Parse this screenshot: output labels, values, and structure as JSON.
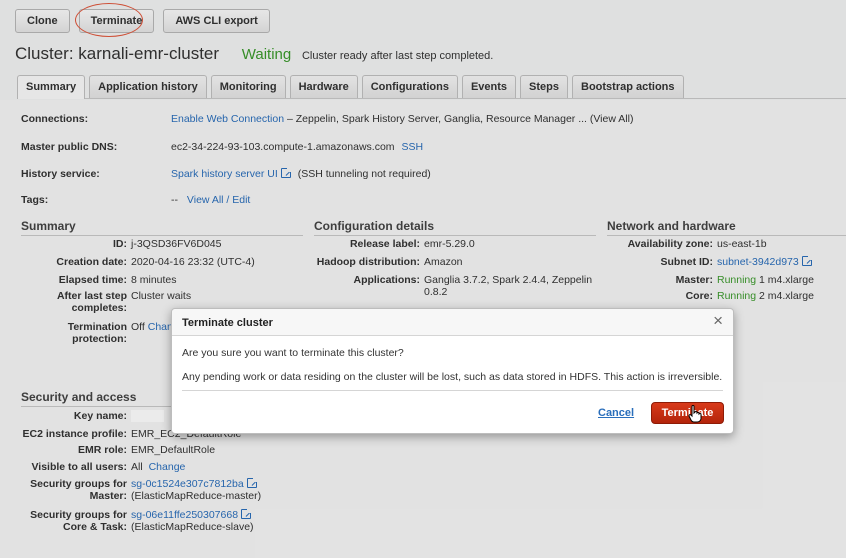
{
  "toolbar": {
    "clone_label": "Clone",
    "terminate_label": "Terminate",
    "export_label": "AWS CLI export"
  },
  "cluster": {
    "title": "Cluster: karnali-emr-cluster",
    "status": "Waiting",
    "status_message": "Cluster ready after last step completed."
  },
  "tabs": [
    {
      "label": "Summary"
    },
    {
      "label": "Application history"
    },
    {
      "label": "Monitoring"
    },
    {
      "label": "Hardware"
    },
    {
      "label": "Configurations"
    },
    {
      "label": "Events"
    },
    {
      "label": "Steps"
    },
    {
      "label": "Bootstrap actions"
    }
  ],
  "overview": {
    "connections_key": "Connections:",
    "connections_link": "Enable Web Connection",
    "connections_text": " – Zeppelin, Spark History Server, Ganglia, Resource Manager ... (View All)",
    "dns_key": "Master public DNS:",
    "dns_value": "ec2-34-224-93-103.compute-1.amazonaws.com",
    "dns_ssh": "SSH",
    "history_key": "History service:",
    "history_link": "Spark history server UI",
    "history_note": "(SSH tunneling not required)",
    "tags_key": "Tags:",
    "tags_value": "--",
    "tags_link": "View All / Edit"
  },
  "summary": {
    "heading": "Summary",
    "id_key": "ID:",
    "id_value": "j-3QSD36FV6D045",
    "creation_key": "Creation date:",
    "creation_value": "2020-04-16 23:32 (UTC-4)",
    "elapsed_key": "Elapsed time:",
    "elapsed_value": "8 minutes",
    "after_key": "After last step completes:",
    "after_value": "Cluster waits",
    "termination_key": "Termination protection:",
    "termination_value": "Off",
    "termination_link": "Change"
  },
  "config": {
    "heading": "Configuration details",
    "release_key": "Release label:",
    "release_value": "emr-5.29.0",
    "hadoop_key": "Hadoop distribution:",
    "hadoop_value": "Amazon",
    "apps_key": "Applications:",
    "apps_value": "Ganglia 3.7.2, Spark 2.4.4, Zeppelin 0.8.2"
  },
  "network": {
    "heading": "Network and hardware",
    "az_key": "Availability zone:",
    "az_value": "us-east-1b",
    "subnet_key": "Subnet ID:",
    "subnet_value": "subnet-3942d973",
    "master_key": "Master:",
    "master_status": "Running",
    "master_value": "1  m4.xlarge",
    "core_key": "Core:",
    "core_status": "Running",
    "core_value": "2  m4.xlarge"
  },
  "security": {
    "heading": "Security and access",
    "key_name_key": "Key name:",
    "profile_key": "EC2 instance profile:",
    "profile_value": "EMR_EC2_DefaultRole",
    "role_key": "EMR role:",
    "role_value": "EMR_DefaultRole",
    "visible_key": "Visible to all users:",
    "visible_value": "All",
    "visible_link": "Change",
    "sg_master_key": "Security groups for Master:",
    "sg_master_link": "sg-0c1524e307c7812ba",
    "sg_master_note": "(ElasticMapReduce-master)",
    "sg_core_key": "Security groups for Core & Task:",
    "sg_core_link": "sg-06e11ffe250307668",
    "sg_core_note": "(ElasticMapReduce-slave)"
  },
  "modal": {
    "title": "Terminate cluster",
    "question": "Are you sure you want to terminate this cluster?",
    "warning": "Any pending work or data residing on the cluster will be lost, such as data stored in HDFS. This action is irreversible.",
    "cancel_label": "Cancel",
    "terminate_label": "Terminate",
    "close_glyph": "×"
  },
  "colors": {
    "link": "#2a6ebb",
    "running": "#3b9a2c",
    "danger": "#c62e10",
    "annotation": "#e0553a"
  }
}
